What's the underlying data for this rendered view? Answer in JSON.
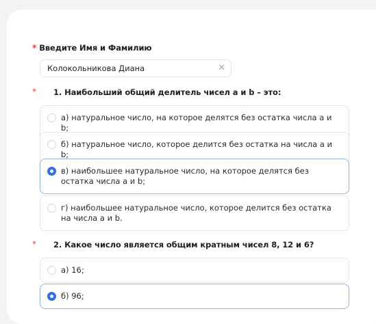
{
  "form": {
    "name_field": {
      "required_mark": "*",
      "label": "Введите Имя и Фамилию",
      "value": "Колокольникова Диана",
      "clear_glyph": "✕"
    },
    "questions": [
      {
        "required_mark": "*",
        "title": "1. Наибольший общий делитель чисел a и b – это:",
        "options": [
          {
            "label": "а) натуральное число, на которое делятся без остатка числа a и b;",
            "selected": false
          },
          {
            "label": "б) натуральное число, которое делится без остатка на числа a и b;",
            "selected": false
          },
          {
            "label": "в) наибольшее натуральное число, на которое делятся без остатка числа a и b;",
            "selected": true
          },
          {
            "label": "г) наибольшее натуральное число, которое делится без остатка на числа a и b.",
            "selected": false
          }
        ]
      },
      {
        "required_mark": "*",
        "title": "2. Какое число является общим кратным чисел 8,  12 и 6?",
        "options": [
          {
            "label": "а) 16;",
            "selected": false
          },
          {
            "label": "б) 96;",
            "selected": true
          }
        ]
      }
    ]
  },
  "colors": {
    "accent": "#2f6fe8",
    "required": "#ff3333",
    "selected_border": "#8bb3f0"
  }
}
